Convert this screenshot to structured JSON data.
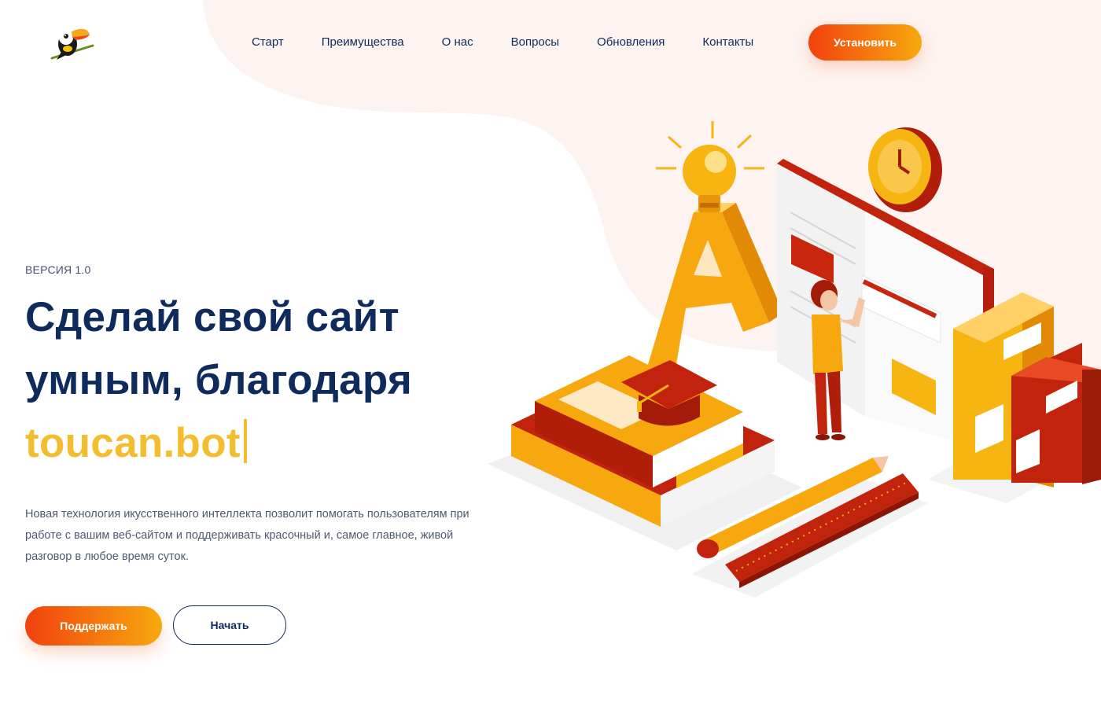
{
  "nav": {
    "items": [
      "Старт",
      "Преимущества",
      "О нас",
      "Вопросы",
      "Обновления",
      "Контакты"
    ],
    "install_label": "Установить"
  },
  "hero": {
    "version_label": "ВЕРСИЯ 1.0",
    "headline_line1": "Сделай свой сайт",
    "headline_line2": "умным, благодаря",
    "headline_brand": "toucan.bot",
    "description": "Новая технология икусственного интеллекта позволит помогать пользователям при работе с вашим веб-сайтом и поддерживать красочный и, самое главное, живой разговор в любое время суток.",
    "support_label": "Поддержать",
    "start_label": "Начать"
  },
  "colors": {
    "navy": "#0f2a5c",
    "accent_yellow": "#f4bd30",
    "gradient_start": "#f2410e",
    "gradient_end": "#f7a90e",
    "blob": "#fdf3f0"
  },
  "icons": {
    "logo": "toucan-logo-icon",
    "illustration": "education-isometric-illustration"
  }
}
